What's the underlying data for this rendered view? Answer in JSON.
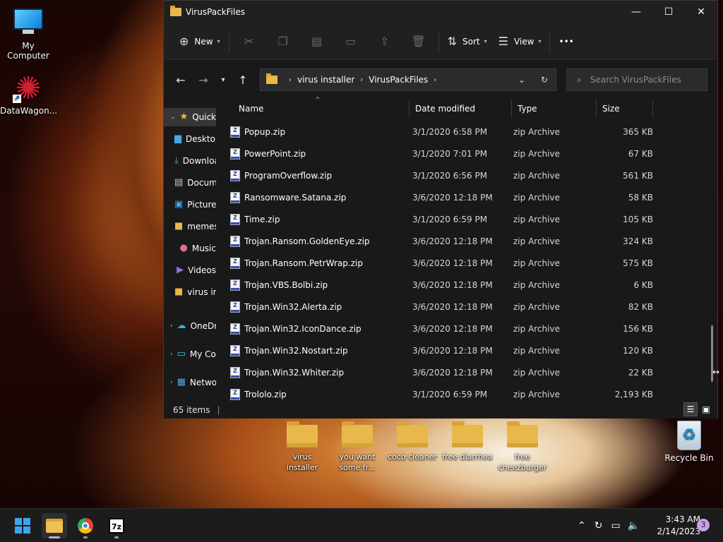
{
  "desktop": {
    "icons": [
      {
        "label": "My Computer"
      },
      {
        "label": "DataWagon..."
      }
    ],
    "folders": [
      {
        "label": "virus installer"
      },
      {
        "label": "you want some fr..."
      },
      {
        "label": "coco cleaner"
      },
      {
        "label": "free diarrhea"
      },
      {
        "label": "free cheezburger"
      }
    ],
    "recycle_bin": "Recycle Bin"
  },
  "window": {
    "title": "VirusPackFiles",
    "controls": {
      "minimize": "—",
      "maximize": "☐",
      "close": "✕"
    }
  },
  "toolbar": {
    "new_label": "New",
    "sort_label": "Sort",
    "view_label": "View",
    "more_label": "•••"
  },
  "address": {
    "crumbs": [
      "virus installer",
      "VirusPackFiles"
    ],
    "search_placeholder": "Search VirusPackFiles"
  },
  "sidebar": {
    "items": [
      {
        "label": "Quick access",
        "icon": "star-icon"
      },
      {
        "label": "Desktop",
        "icon": "desktop-icon"
      },
      {
        "label": "Downloads",
        "icon": "download-icon"
      },
      {
        "label": "Documents",
        "icon": "document-icon"
      },
      {
        "label": "Pictures",
        "icon": "picture-icon"
      },
      {
        "label": "memes",
        "icon": "folder-icon"
      },
      {
        "label": "Music",
        "icon": "music-icon"
      },
      {
        "label": "Videos",
        "icon": "video-icon"
      },
      {
        "label": "virus installer",
        "icon": "folder-icon"
      },
      {
        "label": "OneDrive",
        "icon": "cloud-icon"
      },
      {
        "label": "My Computer",
        "icon": "computer-icon"
      },
      {
        "label": "Network",
        "icon": "network-icon"
      }
    ]
  },
  "columns": {
    "name": "Name",
    "date": "Date modified",
    "type": "Type",
    "size": "Size"
  },
  "files": [
    {
      "name": "Popup.zip",
      "date": "3/1/2020 6:58 PM",
      "type": "zip Archive",
      "size": "365 KB"
    },
    {
      "name": "PowerPoint.zip",
      "date": "3/1/2020 7:01 PM",
      "type": "zip Archive",
      "size": "67 KB"
    },
    {
      "name": "ProgramOverflow.zip",
      "date": "3/1/2020 6:56 PM",
      "type": "zip Archive",
      "size": "561 KB"
    },
    {
      "name": "Ransomware.Satana.zip",
      "date": "3/6/2020 12:18 PM",
      "type": "zip Archive",
      "size": "58 KB"
    },
    {
      "name": "Time.zip",
      "date": "3/1/2020 6:59 PM",
      "type": "zip Archive",
      "size": "105 KB"
    },
    {
      "name": "Trojan.Ransom.GoldenEye.zip",
      "date": "3/6/2020 12:18 PM",
      "type": "zip Archive",
      "size": "324 KB"
    },
    {
      "name": "Trojan.Ransom.PetrWrap.zip",
      "date": "3/6/2020 12:18 PM",
      "type": "zip Archive",
      "size": "575 KB"
    },
    {
      "name": "Trojan.VBS.Bolbi.zip",
      "date": "3/6/2020 12:18 PM",
      "type": "zip Archive",
      "size": "6 KB"
    },
    {
      "name": "Trojan.Win32.Alerta.zip",
      "date": "3/6/2020 12:18 PM",
      "type": "zip Archive",
      "size": "82 KB"
    },
    {
      "name": "Trojan.Win32.IconDance.zip",
      "date": "3/6/2020 12:18 PM",
      "type": "zip Archive",
      "size": "156 KB"
    },
    {
      "name": "Trojan.Win32.Nostart.zip",
      "date": "3/6/2020 12:18 PM",
      "type": "zip Archive",
      "size": "120 KB"
    },
    {
      "name": "Trojan.Win32.Whiter.zip",
      "date": "3/6/2020 12:18 PM",
      "type": "zip Archive",
      "size": "22 KB"
    },
    {
      "name": "Trololo.zip",
      "date": "3/1/2020 6:59 PM",
      "type": "zip Archive",
      "size": "2,193 KB"
    }
  ],
  "status": {
    "item_count": "65 items",
    "separator": "|"
  },
  "taskbar": {
    "time": "3:43 AM",
    "date": "2/14/2023",
    "notification_count": "3",
    "sevenz_label": "7z"
  },
  "colors": {
    "accent": "#3aa6f0",
    "folder": "#e8b84a",
    "window_bg": "#191919"
  }
}
